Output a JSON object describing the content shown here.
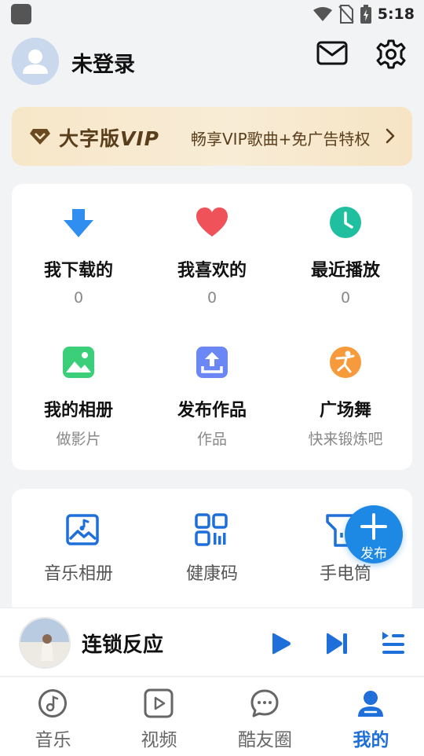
{
  "status_bar": {
    "time": "5:18"
  },
  "profile": {
    "username": "未登录"
  },
  "vip": {
    "title_prefix": "大字版",
    "title_vip": "VIP",
    "subtitle": "畅享VIP歌曲+免广告特权"
  },
  "grid": [
    {
      "title": "我下载的",
      "sub": "0",
      "icon": "download-icon"
    },
    {
      "title": "我喜欢的",
      "sub": "0",
      "icon": "heart-icon"
    },
    {
      "title": "最近播放",
      "sub": "0",
      "icon": "clock-icon"
    },
    {
      "title": "我的相册",
      "sub": "做影片",
      "icon": "album-icon"
    },
    {
      "title": "发布作品",
      "sub": "作品",
      "icon": "upload-icon"
    },
    {
      "title": "广场舞",
      "sub": "快来锻炼吧",
      "icon": "dance-icon"
    }
  ],
  "tools": [
    {
      "label": "音乐相册",
      "icon": "music-album-icon"
    },
    {
      "label": "健康码",
      "icon": "qr-code-icon"
    },
    {
      "label": "手电筒",
      "icon": "flashlight-icon"
    }
  ],
  "fab": {
    "label": "发布"
  },
  "player": {
    "song": "连锁反应"
  },
  "tabs": [
    {
      "label": "音乐",
      "icon": "music-note-icon"
    },
    {
      "label": "视频",
      "icon": "video-icon"
    },
    {
      "label": "酷友圈",
      "icon": "chat-icon"
    },
    {
      "label": "我的",
      "icon": "person-icon"
    }
  ],
  "colors": {
    "accent": "#1e6fd9",
    "vip_text": "#5a3e1b",
    "vip_bg": "#f7e7c9"
  }
}
